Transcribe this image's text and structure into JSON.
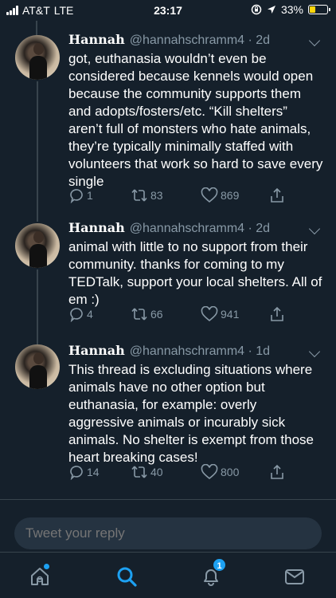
{
  "status_bar": {
    "carrier": "AT&T",
    "network": "LTE",
    "time": "23:17",
    "battery_percent": "33%",
    "battery_level": 0.33,
    "battery_color": "#ffd60a"
  },
  "tweets": [
    {
      "name": "Hannah",
      "handle": "@hannahschramm4 · 2d",
      "text": "got, euthanasia wouldn’t even be considered because kennels would open because the community supports them and adopts/fosters/etc. “Kill shelters” aren’t full of monsters who hate animals, they’re typically minimally staffed with volunteers that work so hard to save every single",
      "replies": "1",
      "retweets": "83",
      "likes": "869"
    },
    {
      "name": "Hannah",
      "handle": "@hannahschramm4 · 2d",
      "text": "animal with little to no support from their community. thanks for coming to my TEDTalk, support your local shelters. All of em :)",
      "replies": "4",
      "retweets": "66",
      "likes": "941"
    },
    {
      "name": "Hannah",
      "handle": "@hannahschramm4 · 1d",
      "text": "This thread is excluding situations where animals have no other option but euthanasia, for example: overly aggressive animals or incurably sick animals. No shelter is exempt from those heart breaking cases!",
      "replies": "14",
      "retweets": "40",
      "likes": "800"
    }
  ],
  "reply": {
    "placeholder": "Tweet your reply"
  },
  "tab_bar": {
    "items": [
      "home-icon",
      "search-icon",
      "notifications-icon",
      "messages-icon"
    ],
    "notifications_badge": "1",
    "accent": "#1da1f2"
  },
  "colors": {
    "background": "#15202b",
    "secondary_text": "#8899a6",
    "divider": "#38444d"
  }
}
